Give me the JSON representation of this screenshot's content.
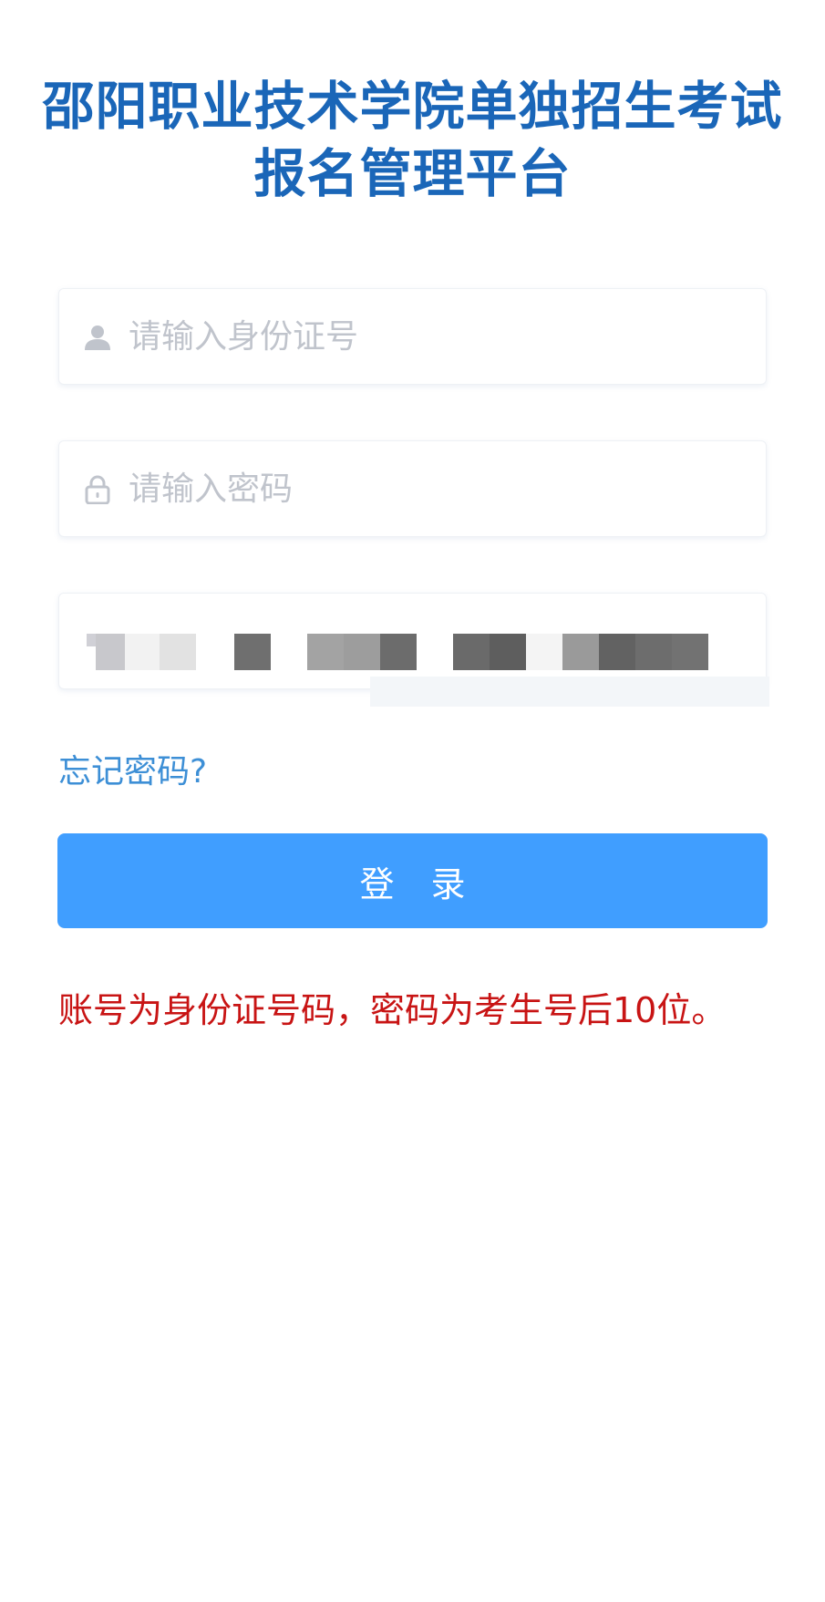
{
  "page": {
    "title": "邵阳职业技术学院单独招生考试报名管理平台"
  },
  "form": {
    "id_number": {
      "placeholder": "请输入身份证号",
      "value": "",
      "icon": "user-icon"
    },
    "password": {
      "placeholder": "请输入密码",
      "value": "",
      "icon": "lock-icon"
    },
    "captcha": {
      "value": "",
      "note": "captcha content pixelated/obscured"
    },
    "forgot_password_label": "忘记密码?",
    "login_label": "登 录"
  },
  "notice": {
    "text": "账号为身份证号码，密码为考生号后10位。"
  },
  "colors": {
    "title": "#1a66b8",
    "link": "#3d8fd6",
    "primary_button": "#409eff",
    "notice": "#c81414",
    "placeholder": "#c0c4cc"
  }
}
